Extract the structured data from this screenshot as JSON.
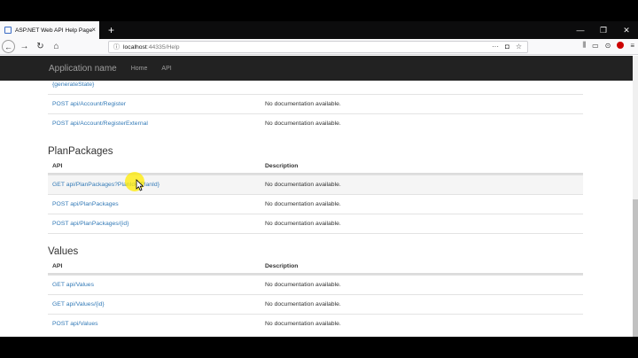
{
  "browser": {
    "tab_title": "ASP.NET Web API Help Page",
    "new_tab_symbol": "+",
    "tab_close_symbol": "×",
    "url_host": "localhost",
    "url_rest": ":44335/Help",
    "window_controls": [
      "—",
      "❐",
      "✕"
    ]
  },
  "app": {
    "brand": "Application name",
    "nav": [
      "Home",
      "API"
    ]
  },
  "top_rows": [
    {
      "api": "{generateState}",
      "desc": ""
    },
    {
      "api": "POST api/Account/Register",
      "desc": "No documentation available."
    },
    {
      "api": "POST api/Account/RegisterExternal",
      "desc": "No documentation available."
    }
  ],
  "sections": [
    {
      "title": "PlanPackages",
      "header_api": "API",
      "header_desc": "Description",
      "rows": [
        {
          "api": "GET api/PlanPackages?PlanId={PlanId}",
          "desc": "No documentation available."
        },
        {
          "api": "POST api/PlanPackages",
          "desc": "No documentation available."
        },
        {
          "api": "POST api/PlanPackages/{id}",
          "desc": "No documentation available."
        }
      ]
    },
    {
      "title": "Values",
      "header_api": "API",
      "header_desc": "Description",
      "rows": [
        {
          "api": "GET api/Values",
          "desc": "No documentation available."
        },
        {
          "api": "GET api/Values/{id}",
          "desc": "No documentation available."
        },
        {
          "api": "POST api/Values",
          "desc": "No documentation available."
        }
      ]
    }
  ]
}
